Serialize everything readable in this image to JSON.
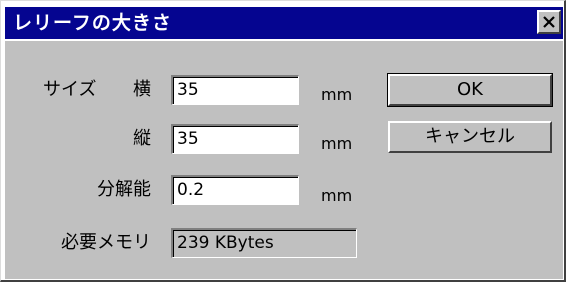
{
  "window": {
    "title": "レリーフの大きさ"
  },
  "form": {
    "size_label": "サイズ",
    "width_label": "横",
    "height_label": "縦",
    "resolution_label": "分解能",
    "memory_label": "必要メモリ",
    "width_value": "35",
    "height_value": "35",
    "resolution_value": "0.2",
    "memory_value": "239 KBytes",
    "unit_width": "mm",
    "unit_height": "mm",
    "unit_resolution": "mm"
  },
  "buttons": {
    "ok_label": "OK",
    "cancel_label": "キャンセル"
  },
  "icons": {
    "close": "close-icon"
  },
  "colors": {
    "titlebar": "#050590",
    "dialog_face": "#c0c0c0",
    "title_text": "#ffffff"
  }
}
